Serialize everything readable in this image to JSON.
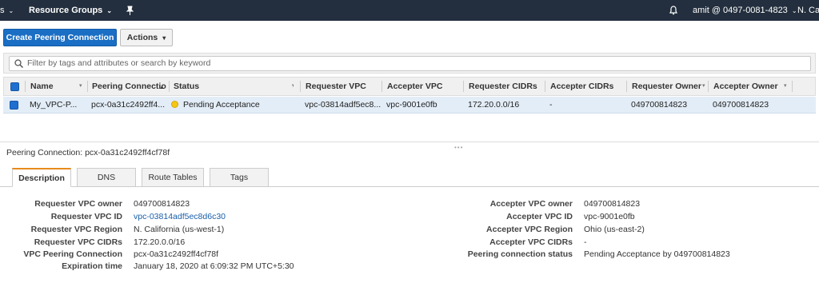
{
  "topnav": {
    "services_fragment": "s",
    "resource_groups": "Resource Groups",
    "account": "amit @ 0497-0081-4823",
    "region": "N. Cali"
  },
  "toolbar": {
    "create_label": "Create Peering Connection",
    "actions_label": "Actions"
  },
  "search": {
    "placeholder": "Filter by tags and attributes or search by keyword"
  },
  "table": {
    "columns": [
      "Name",
      "Peering Connectio",
      "Status",
      "Requester VPC",
      "Accepter VPC",
      "Requester CIDRs",
      "Accepter CIDRs",
      "Requester Owner",
      "Accepter Owner"
    ],
    "rows": [
      {
        "name": "My_VPC-P...",
        "peering_connection": "pcx-0a31c2492ff4...",
        "status": "Pending Acceptance",
        "requester_vpc": "vpc-03814adf5ec8...",
        "accepter_vpc": "vpc-9001e0fb",
        "requester_cidrs": "172.20.0.0/16",
        "accepter_cidrs": "-",
        "requester_owner": "049700814823",
        "accepter_owner": "049700814823"
      }
    ]
  },
  "detail": {
    "title_label": "Peering Connection:",
    "title_value": "pcx-0a31c2492ff4cf78f",
    "tabs": [
      "Description",
      "DNS",
      "Route Tables",
      "Tags"
    ],
    "left": [
      {
        "label": "Requester VPC owner",
        "value": "049700814823"
      },
      {
        "label": "Requester VPC ID",
        "value": "vpc-03814adf5ec8d6c30"
      },
      {
        "label": "Requester VPC Region",
        "value": "N. California (us-west-1)"
      },
      {
        "label": "Requester VPC CIDRs",
        "value": "172.20.0.0/16"
      },
      {
        "label": "VPC Peering Connection",
        "value": "pcx-0a31c2492ff4cf78f"
      },
      {
        "label": "Expiration time",
        "value": "January 18, 2020 at 6:09:32 PM UTC+5:30"
      }
    ],
    "right": [
      {
        "label": "Accepter VPC owner",
        "value": "049700814823"
      },
      {
        "label": "Accepter VPC ID",
        "value": "vpc-9001e0fb"
      },
      {
        "label": "Accepter VPC Region",
        "value": "Ohio (us-east-2)"
      },
      {
        "label": "Accepter VPC CIDRs",
        "value": "-"
      },
      {
        "label": "Peering connection status",
        "value": "Pending Acceptance by 049700814823"
      }
    ]
  },
  "colors": {
    "nav_bg": "#232f3e",
    "primary": "#1a6ec4",
    "active_tab_accent": "#e88a1a",
    "selected_row": "#e3edf7",
    "status_pending": "#f5c518",
    "link": "#1a5ea8"
  }
}
